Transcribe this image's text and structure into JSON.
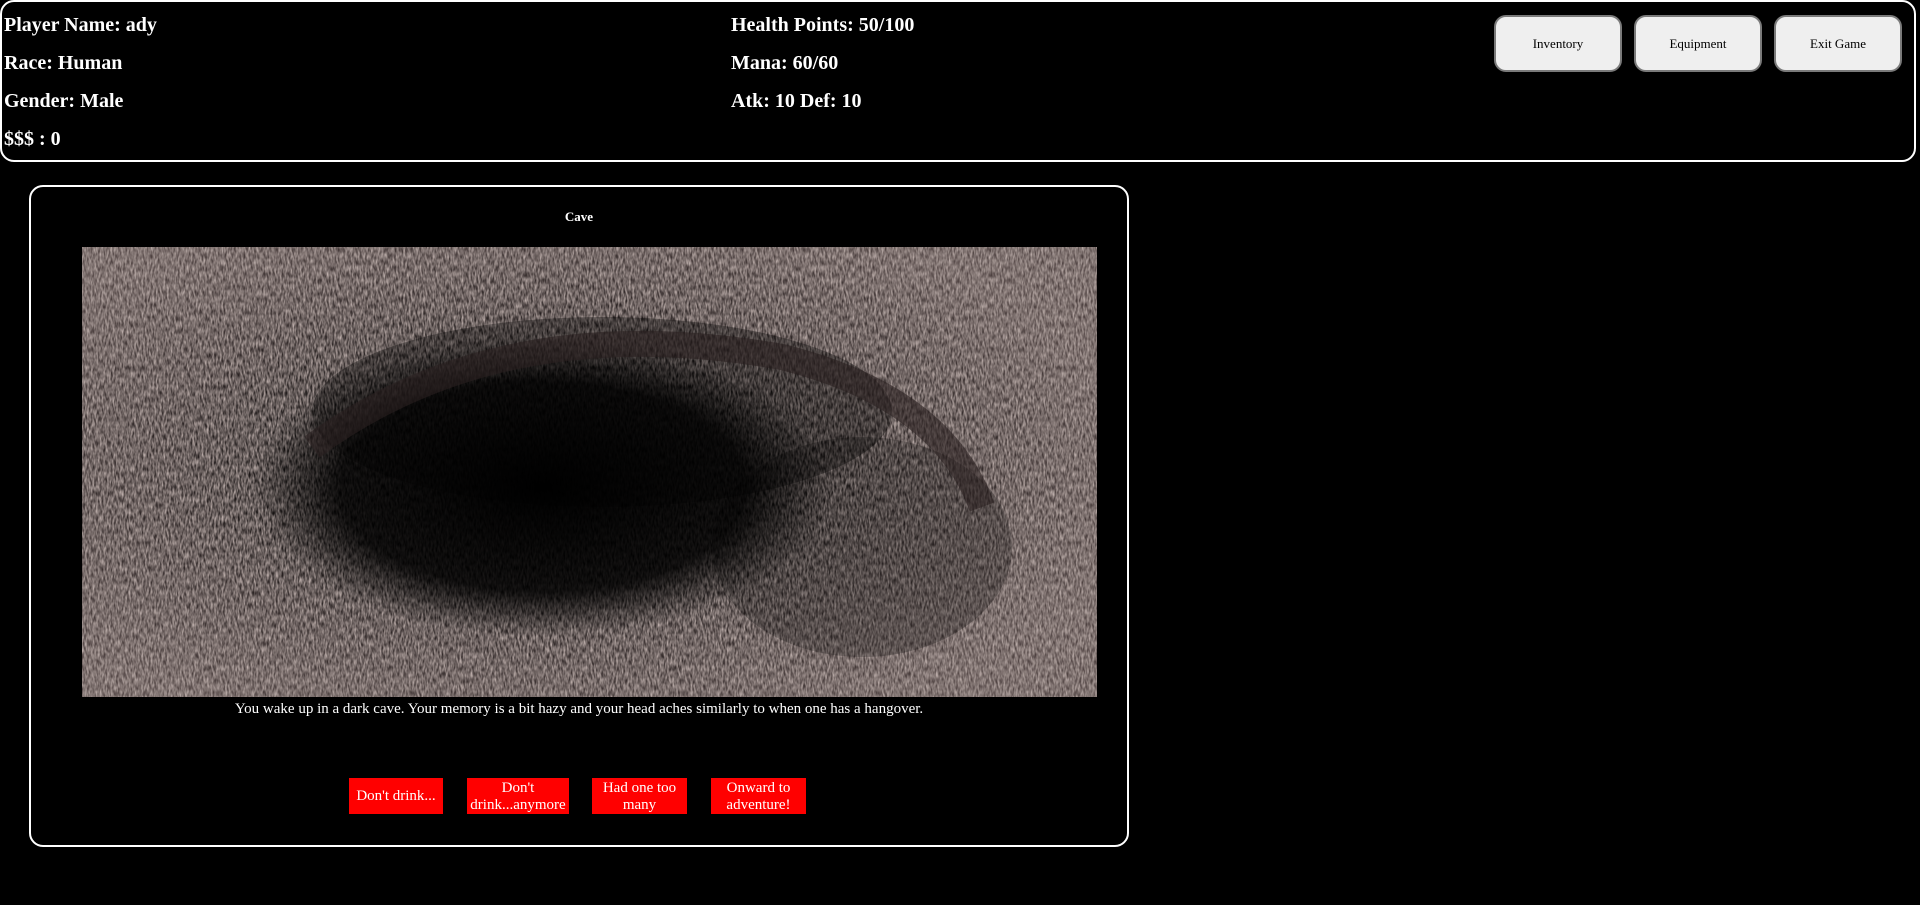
{
  "player": {
    "name_line": "Player Name: ady",
    "race_line": "Race: Human",
    "gender_line": "Gender: Male",
    "money_line": "$$$ : 0",
    "health_line": "Health Points: 50/100",
    "mana_line": "Mana: 60/60",
    "combat_line": "Atk: 10 Def: 10"
  },
  "menu": {
    "inventory": "Inventory",
    "equipment": "Equipment",
    "exit": "Exit Game"
  },
  "scene": {
    "title": "Cave",
    "description": "You wake up in a dark cave. Your memory is a bit hazy and your head aches similarly to when one has a hangover.",
    "choices": [
      "Don't drink...",
      "Don't drink...anymore",
      "Had one too many",
      "Onward to adventure!"
    ]
  }
}
